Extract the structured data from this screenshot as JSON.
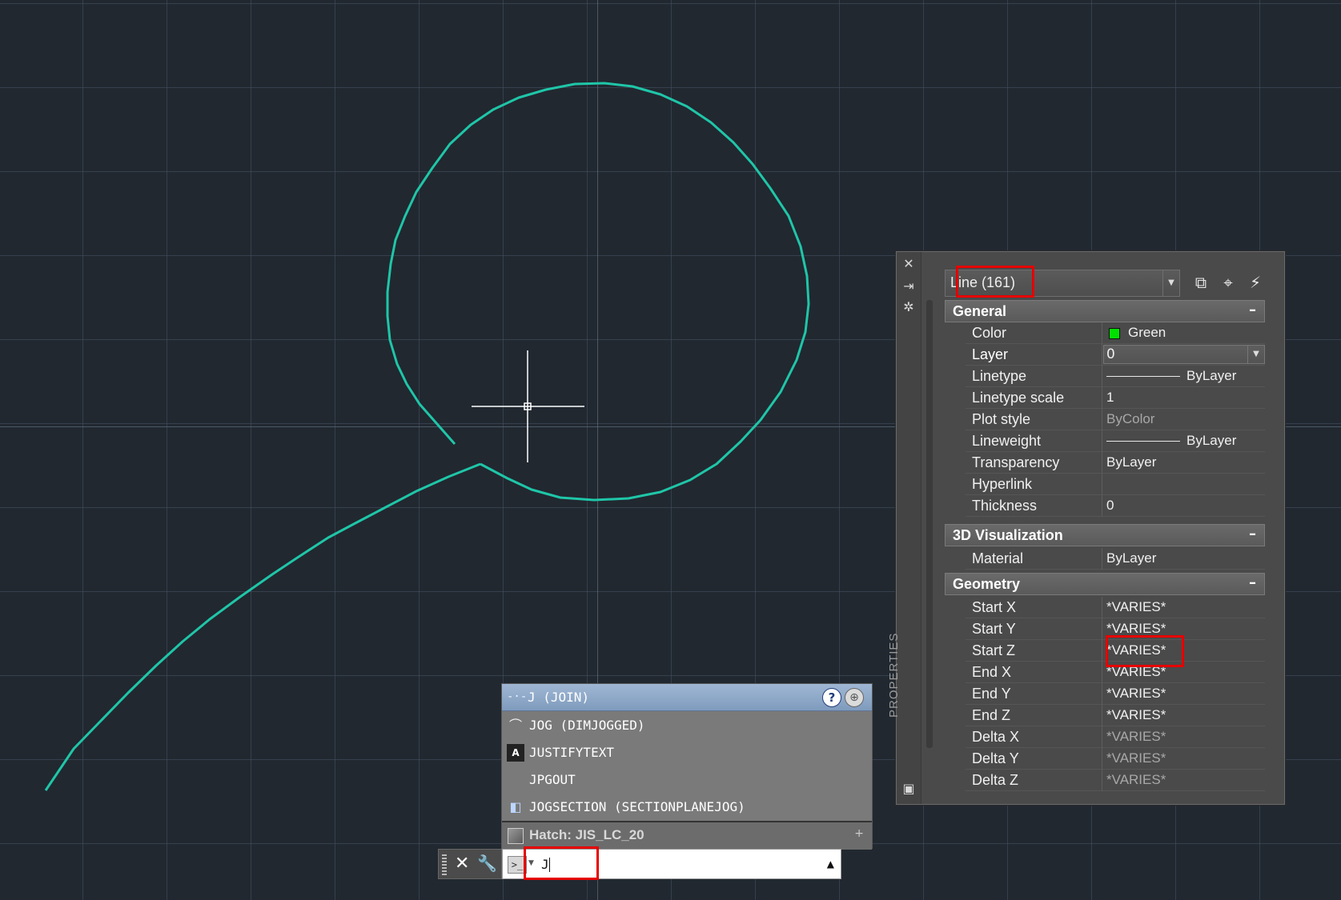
{
  "properties": {
    "title": "PROPERTIES",
    "selection": "Line (161)",
    "sections": {
      "general": {
        "title": "General",
        "collapse": "–",
        "rows": [
          {
            "label": "Color",
            "value": "Green"
          },
          {
            "label": "Layer",
            "value": "0"
          },
          {
            "label": "Linetype",
            "value": "ByLayer"
          },
          {
            "label": "Linetype scale",
            "value": "1"
          },
          {
            "label": "Plot style",
            "value": "ByColor"
          },
          {
            "label": "Lineweight",
            "value": "ByLayer"
          },
          {
            "label": "Transparency",
            "value": "ByLayer"
          },
          {
            "label": "Hyperlink",
            "value": ""
          },
          {
            "label": "Thickness",
            "value": "0"
          }
        ]
      },
      "visualization": {
        "title": "3D Visualization",
        "collapse": "–",
        "rows": [
          {
            "label": "Material",
            "value": "ByLayer"
          }
        ]
      },
      "geometry": {
        "title": "Geometry",
        "collapse": "–",
        "rows": [
          {
            "label": "Start X",
            "value": "*VARIES*"
          },
          {
            "label": "Start Y",
            "value": "*VARIES*"
          },
          {
            "label": "Start Z",
            "value": "*VARIES*"
          },
          {
            "label": "End X",
            "value": "*VARIES*"
          },
          {
            "label": "End Y",
            "value": "*VARIES*"
          },
          {
            "label": "End Z",
            "value": "*VARIES*"
          },
          {
            "label": "Delta X",
            "value": "*VARIES*"
          },
          {
            "label": "Delta Y",
            "value": "*VARIES*"
          },
          {
            "label": "Delta Z",
            "value": "*VARIES*"
          }
        ]
      }
    },
    "colors": {
      "swatch": "#00e000",
      "highlight": "#e60000"
    }
  },
  "autocomplete": {
    "header": "J (JOIN)",
    "header_icon": "-·-",
    "items": [
      {
        "label": "JOG (DIMJOGGED)",
        "icon": "dimjogged-icon"
      },
      {
        "label": "JUSTIFYTEXT",
        "icon": "justifytext-icon"
      },
      {
        "label": "JPGOUT",
        "icon": ""
      },
      {
        "label": "JOGSECTION (SECTIONPLANEJOG)",
        "icon": "sectionplane-icon"
      }
    ],
    "hatch": "Hatch: JIS_LC_20",
    "hatch_plus": "+"
  },
  "command_line": {
    "input": "J",
    "prompt_icon": ">_"
  },
  "drawing": {
    "stroke_color": "#1fc6a8"
  }
}
